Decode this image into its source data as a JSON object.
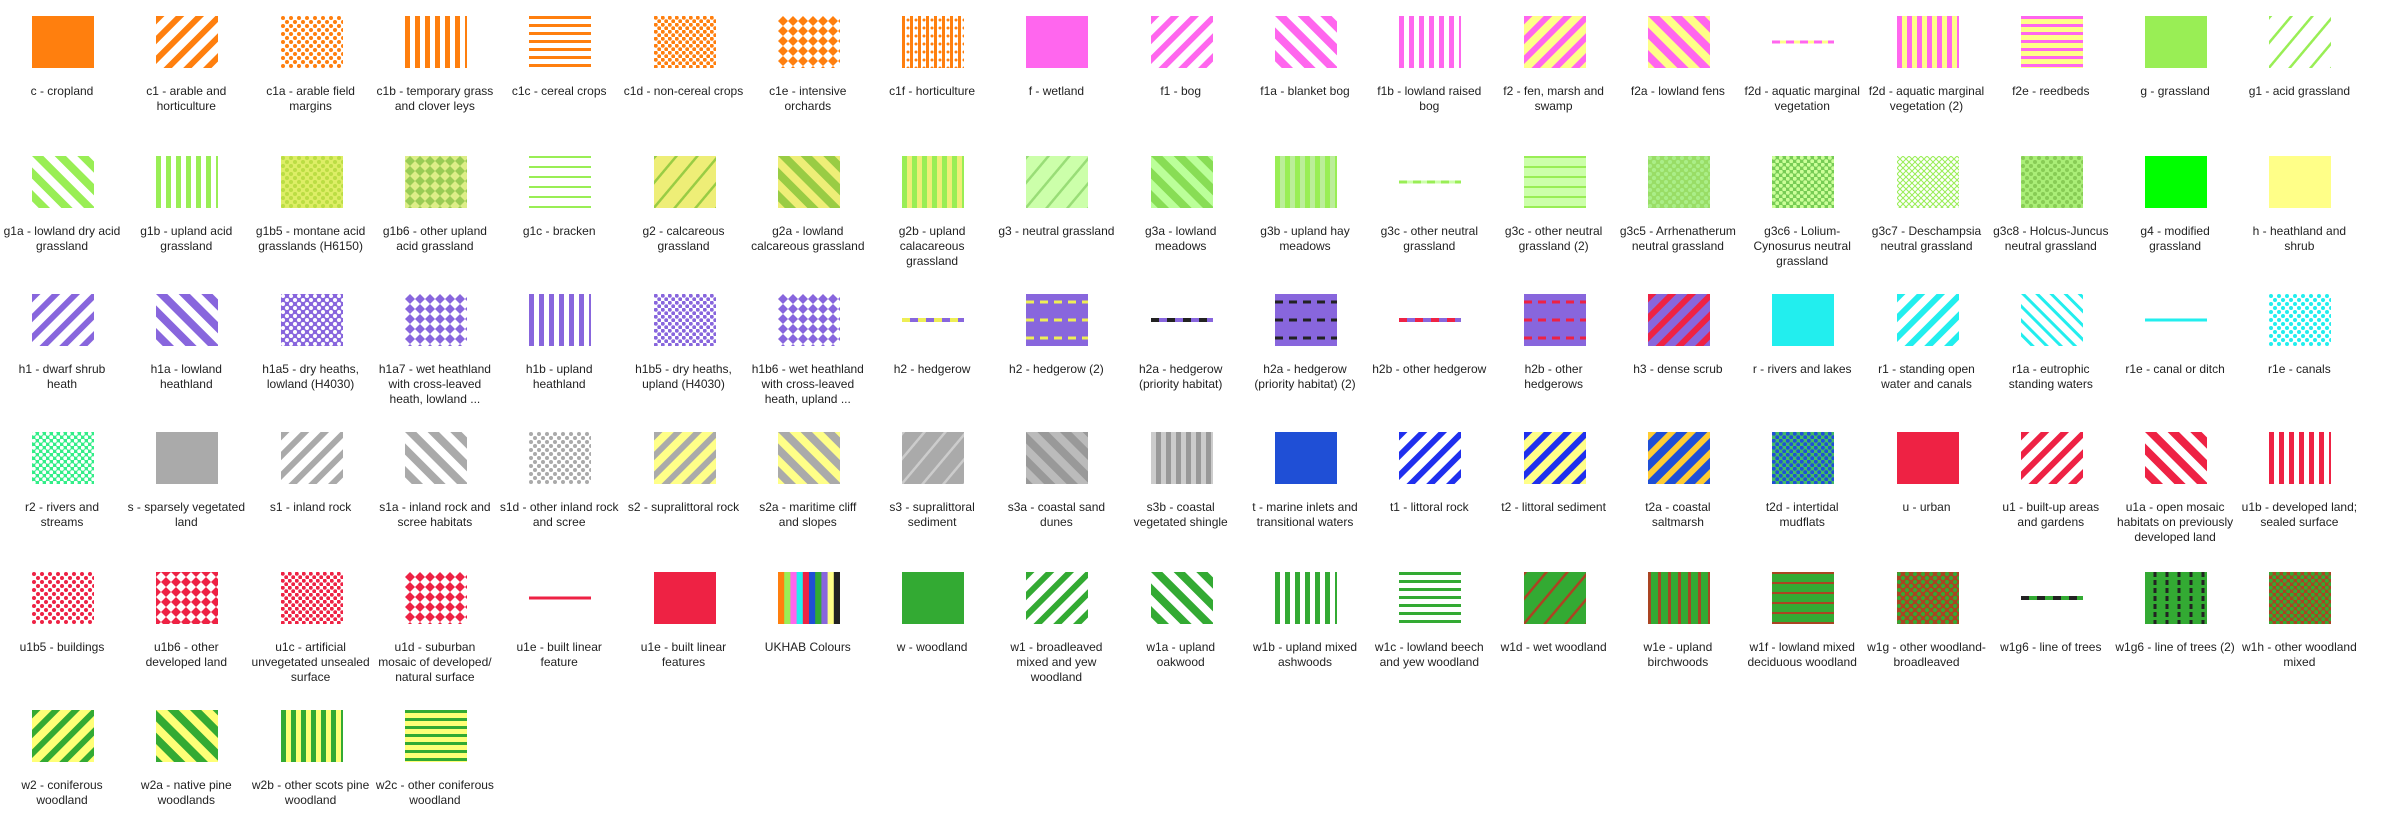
{
  "items": [
    {
      "label": "c - cropland",
      "fill": "solid",
      "color": "#ff7f0e",
      "bg": "#ff7f0e"
    },
    {
      "label": "c1 - arable and horticulture",
      "fill": "diag_fwd",
      "color": "#ff7f0e",
      "bg": "#ffffff"
    },
    {
      "label": "c1a - arable field margins",
      "fill": "dots",
      "color": "#ff7f0e",
      "bg": "#ffffff"
    },
    {
      "label": "c1b - temporary grass and clover leys",
      "fill": "vertical",
      "color": "#ff7f0e",
      "bg": "#ffffff"
    },
    {
      "label": "c1c - cereal crops",
      "fill": "horizontal",
      "color": "#ff7f0e",
      "bg": "#ffffff"
    },
    {
      "label": "c1d - non-cereal crops",
      "fill": "dots_dense",
      "color": "#ff7f0e",
      "bg": "#ffffff"
    },
    {
      "label": "c1e - intensive orchards",
      "fill": "diamonds",
      "color": "#ff7f0e",
      "bg": "#ffffff"
    },
    {
      "label": "c1f - horticulture",
      "fill": "dots_vertical",
      "color": "#ff7f0e",
      "bg": "#ffffff"
    },
    {
      "label": "f - wetland",
      "fill": "solid",
      "color": "#ff66ee",
      "bg": "#ff66ee"
    },
    {
      "label": "f1 - bog",
      "fill": "diag_fwd",
      "color": "#ff66ee",
      "bg": "#ffffff"
    },
    {
      "label": "f1a - blanket bog",
      "fill": "diag_back",
      "color": "#ff66ee",
      "bg": "#ffffff"
    },
    {
      "label": "f1b - lowland raised bog",
      "fill": "vertical",
      "color": "#ff66ee",
      "bg": "#ffffff"
    },
    {
      "label": "f2 - fen, marsh and swamp",
      "fill": "diag_fwd",
      "color": "#ff66ee",
      "bg": "#ffff88"
    },
    {
      "label": "f2a - lowland fens",
      "fill": "diag_back",
      "color": "#ff66ee",
      "bg": "#ffff88"
    },
    {
      "label": "f2d - aquatic marginal vegetation",
      "fill": "line_dash",
      "color": "#ff66ee",
      "bg": "#ffff88"
    },
    {
      "label": "f2d - aquatic marginal vegetation (2)",
      "fill": "vertical",
      "color": "#ff66ee",
      "bg": "#ffff88"
    },
    {
      "label": "f2e - reedbeds",
      "fill": "horizontal",
      "color": "#ff66ee",
      "bg": "#ffff88"
    },
    {
      "label": "g - grassland",
      "fill": "solid",
      "color": "#99ee55",
      "bg": "#99ee55"
    },
    {
      "label": "g1 - acid grassland",
      "fill": "diag_fwd_thin",
      "color": "#99ee55",
      "bg": "#ffffff"
    },
    {
      "label": "g1a - lowland dry acid grassland",
      "fill": "diag_back",
      "color": "#99ee55",
      "bg": "#ffffff"
    },
    {
      "label": "g1b - upland acid grassland",
      "fill": "vertical",
      "color": "#99ee55",
      "bg": "#ffffff"
    },
    {
      "label": "g1b5 - montane acid grasslands (H6150)",
      "fill": "dots",
      "color": "#bbdd44",
      "bg": "#ddee66"
    },
    {
      "label": "g1b6 - other upland acid grassland",
      "fill": "diamonds",
      "color": "#99cc55",
      "bg": "#ddee88"
    },
    {
      "label": "g1c - bracken",
      "fill": "horizontal_thin",
      "color": "#99ee55",
      "bg": "#ffffff"
    },
    {
      "label": "g2 - calcareous grassland",
      "fill": "diag_fwd_thin",
      "color": "#99cc44",
      "bg": "#eeee77"
    },
    {
      "label": "g2a - lowland calcareous grassland",
      "fill": "diag_back",
      "color": "#99cc44",
      "bg": "#eeee77"
    },
    {
      "label": "g2b - upland calacareous grassland",
      "fill": "vertical",
      "color": "#99ee55",
      "bg": "#eeee77"
    },
    {
      "label": "g3 - neutral grassland",
      "fill": "diag_fwd_thin",
      "color": "#99dd77",
      "bg": "#ccffaa"
    },
    {
      "label": "g3a - lowland meadows",
      "fill": "diag_back",
      "color": "#88dd55",
      "bg": "#bbff99"
    },
    {
      "label": "g3b - upland hay meadows",
      "fill": "vertical",
      "color": "#99ee55",
      "bg": "#bbee99"
    },
    {
      "label": "g3c - other neutral grassland",
      "fill": "line_dash",
      "color": "#99ee55",
      "bg": "#ccffaa"
    },
    {
      "label": "g3c - other neutral grassland (2)",
      "fill": "horizontal_thin",
      "color": "#99ee55",
      "bg": "#ccffaa"
    },
    {
      "label": "g3c5 - Arrhenatherum neutral grassland",
      "fill": "dots",
      "color": "#aaee88",
      "bg": "#99dd66"
    },
    {
      "label": "g3c6 - Lolium-Cynosurus neutral grassland",
      "fill": "dots_dense",
      "color": "#ccff99",
      "bg": "#77cc55"
    },
    {
      "label": "g3c7 - Deschampsia neutral grassland",
      "fill": "crosshatch",
      "color": "#99ee55",
      "bg": "#ffffff"
    },
    {
      "label": "g3c8 - Holcus-Juncus neutral grassland",
      "fill": "dots",
      "color": "#88cc55",
      "bg": "#aaee77"
    },
    {
      "label": "g4 - modified grassland",
      "fill": "solid",
      "color": "#00ff00",
      "bg": "#00ff00"
    },
    {
      "label": "h - heathland and shrub",
      "fill": "solid",
      "color": "#ffff88",
      "bg": "#ffff88"
    },
    {
      "label": "h1 - dwarf shrub heath",
      "fill": "diag_fwd",
      "color": "#8866dd",
      "bg": "#ffffff"
    },
    {
      "label": "h1a - lowland heathland",
      "fill": "diag_back",
      "color": "#8866dd",
      "bg": "#ffffff"
    },
    {
      "label": "h1a5 - dry heaths, lowland (H4030)",
      "fill": "dots",
      "color": "#ffffff",
      "bg": "#8866dd"
    },
    {
      "label": "h1a7 - wet heathland with cross-leaved heath, lowland ...",
      "fill": "diamonds",
      "color": "#8866dd",
      "bg": "#ffffff"
    },
    {
      "label": "h1b - upland heathland",
      "fill": "vertical",
      "color": "#8866dd",
      "bg": "#ffffff"
    },
    {
      "label": "h1b5 - dry heaths, upland (H4030)",
      "fill": "dots_dense",
      "color": "#8866dd",
      "bg": "#ffffff"
    },
    {
      "label": "h1b6 - wet heathland with cross-leaved heath, upland ...",
      "fill": "diamonds",
      "color": "#8866dd",
      "bg": "#ffffff"
    },
    {
      "label": "h2 - hedgerow",
      "fill": "line_dash_two",
      "color": "#8866dd",
      "bg": "#eeee55"
    },
    {
      "label": "h2 - hedgerow (2)",
      "fill": "dashes_box",
      "color": "#eeee55",
      "bg": "#8866dd"
    },
    {
      "label": "h2a - hedgerow (priority habitat)",
      "fill": "line_dash_two",
      "color": "#8866dd",
      "bg": "#222222"
    },
    {
      "label": "h2a - hedgerow (priority habitat) (2)",
      "fill": "dashes_box",
      "color": "#222222",
      "bg": "#8866dd"
    },
    {
      "label": "h2b - other hedgerow",
      "fill": "line_dash_two",
      "color": "#8866dd",
      "bg": "#ee2244"
    },
    {
      "label": "h2b - other hedgerows",
      "fill": "dashes_box",
      "color": "#ee2244",
      "bg": "#8866dd"
    },
    {
      "label": "h3 - dense scrub",
      "fill": "diag_fwd",
      "color": "#ee2244",
      "bg": "#8866dd"
    },
    {
      "label": "r - rivers and lakes",
      "fill": "solid",
      "color": "#22eeee",
      "bg": "#22eeee"
    },
    {
      "label": "r1 - standing open water and canals",
      "fill": "diag_fwd",
      "color": "#22eeee",
      "bg": "#ffffff"
    },
    {
      "label": "r1a - eutrophic standing waters",
      "fill": "diag_back_thin",
      "color": "#22eeee",
      "bg": "#ffffff"
    },
    {
      "label": "r1e - canal or ditch",
      "fill": "line_dash",
      "color": "#22eeee",
      "bg": "#ffffff"
    },
    {
      "label": "r1e - canals",
      "fill": "dots",
      "color": "#22eeee",
      "bg": "#ffffff"
    },
    {
      "label": "r2 - rivers and streams",
      "fill": "dots_dense",
      "color": "#ffffff",
      "bg": "#33ee88"
    },
    {
      "label": "s - sparsely vegetated land",
      "fill": "solid",
      "color": "#aaaaaa",
      "bg": "#aaaaaa"
    },
    {
      "label": "s1 - inland rock",
      "fill": "diag_fwd",
      "color": "#aaaaaa",
      "bg": "#ffffff"
    },
    {
      "label": "s1a - inland rock and scree habitats",
      "fill": "diag_back",
      "color": "#aaaaaa",
      "bg": "#ffffff"
    },
    {
      "label": "s1d - other inland rock and scree",
      "fill": "dots",
      "color": "#aaaaaa",
      "bg": "#ffffff"
    },
    {
      "label": "s2 - supralittoral rock",
      "fill": "diag_fwd",
      "color": "#aaaaaa",
      "bg": "#ffff88"
    },
    {
      "label": "s2a - maritime cliff and slopes",
      "fill": "diag_back",
      "color": "#aaaaaa",
      "bg": "#ffff88"
    },
    {
      "label": "s3 - supralittoral sediment",
      "fill": "diag_fwd_thin",
      "color": "#cccccc",
      "bg": "#aaaaaa"
    },
    {
      "label": "s3a - coastal sand dunes",
      "fill": "diag_back",
      "color": "#bbbbbb",
      "bg": "#999999"
    },
    {
      "label": "s3b - coastal vegetated shingle",
      "fill": "vertical",
      "color": "#cccccc",
      "bg": "#999999"
    },
    {
      "label": "t - marine inlets and transitional waters",
      "fill": "solid",
      "color": "#1f4fd6",
      "bg": "#1f4fd6"
    },
    {
      "label": "t1 - littoral rock",
      "fill": "diag_fwd",
      "color": "#1f2fee",
      "bg": "#ffffff"
    },
    {
      "label": "t2 - littoral sediment",
      "fill": "diag_fwd",
      "color": "#1f2fee",
      "bg": "#ffff88"
    },
    {
      "label": "t2a - coastal saltmarsh",
      "fill": "diag_fwd",
      "color": "#ffcc33",
      "bg": "#1f4fd6"
    },
    {
      "label": "t2d - intertidal mudflats",
      "fill": "dots_dense",
      "color": "#1f4fd6",
      "bg": "#44bb66"
    },
    {
      "label": "u - urban",
      "fill": "solid",
      "color": "#ee2244",
      "bg": "#ee2244"
    },
    {
      "label": "u1 - built-up areas and gardens",
      "fill": "diag_fwd",
      "color": "#ee2244",
      "bg": "#ffffff"
    },
    {
      "label": "u1a - open mosaic habitats on previously developed land",
      "fill": "diag_back",
      "color": "#ee2244",
      "bg": "#ffffff"
    },
    {
      "label": "u1b - developed land; sealed surface",
      "fill": "vertical",
      "color": "#ee2244",
      "bg": "#ffffff"
    },
    {
      "label": "u1b5 - buildings",
      "fill": "dots",
      "color": "#ee2244",
      "bg": "#ffffff"
    },
    {
      "label": "u1b6 - other developed land",
      "fill": "diamonds",
      "color": "#ffffff",
      "bg": "#ee2244"
    },
    {
      "label": "u1c - artificial unvegetated unsealed surface",
      "fill": "dots_dense",
      "color": "#ee2244",
      "bg": "#ffffff"
    },
    {
      "label": "u1d - suburban mosaic of developed/ natural surface",
      "fill": "diamonds",
      "color": "#ee2244",
      "bg": "#ffffff"
    },
    {
      "label": "u1e - built linear feature",
      "fill": "line_dash",
      "color": "#ee2244",
      "bg": "#ee2244"
    },
    {
      "label": "u1e - built linear features",
      "fill": "solid",
      "color": "#ee2244",
      "bg": "#ee2244"
    },
    {
      "label": "UKHAB Colours",
      "fill": "rainbow",
      "color": "#ffffff",
      "bg": "#ffffff"
    },
    {
      "label": "w - woodland",
      "fill": "solid",
      "color": "#33aa33",
      "bg": "#33aa33"
    },
    {
      "label": "w1 - broadleaved mixed and yew woodland",
      "fill": "diag_fwd",
      "color": "#33aa33",
      "bg": "#ffffff"
    },
    {
      "label": "w1a - upland oakwood",
      "fill": "diag_back",
      "color": "#33aa33",
      "bg": "#ffffff"
    },
    {
      "label": "w1b - upland mixed ashwoods",
      "fill": "vertical",
      "color": "#33aa33",
      "bg": "#ffffff"
    },
    {
      "label": "w1c - lowland beech and yew woodland",
      "fill": "horizontal",
      "color": "#33aa33",
      "bg": "#ffffff"
    },
    {
      "label": "w1d - wet woodland",
      "fill": "diag_fwd_thin",
      "color": "#aa4422",
      "bg": "#33aa33"
    },
    {
      "label": "w1e - upland birchwoods",
      "fill": "vertical_thin",
      "color": "#aa4422",
      "bg": "#33aa33"
    },
    {
      "label": "w1f - lowland mixed deciduous woodland",
      "fill": "horizontal_thin",
      "color": "#aa4422",
      "bg": "#33aa33"
    },
    {
      "label": "w1g - other woodland-broadleaved",
      "fill": "dots",
      "color": "#33aa33",
      "bg": "#aa4422"
    },
    {
      "label": "w1g6 - line of trees",
      "fill": "line_dash_two",
      "color": "#33aa33",
      "bg": "#222222"
    },
    {
      "label": "w1g6 - line of trees (2)",
      "fill": "dashes_vert",
      "color": "#222222",
      "bg": "#33aa33"
    },
    {
      "label": "w1h - other woodland mixed",
      "fill": "dots_dense",
      "color": "#33aa33",
      "bg": "#aa4422"
    },
    {
      "label": "w2 - coniferous woodland",
      "fill": "diag_fwd",
      "color": "#33aa33",
      "bg": "#ffff77"
    },
    {
      "label": "w2a - native pine woodlands",
      "fill": "diag_back",
      "color": "#ffff77",
      "bg": "#33aa33"
    },
    {
      "label": "w2b - other scots pine woodland",
      "fill": "vertical",
      "color": "#33aa33",
      "bg": "#ffff77"
    },
    {
      "label": "w2c - other coniferous woodland",
      "fill": "horizontal",
      "color": "#33aa33",
      "bg": "#ffff77"
    }
  ],
  "rainbow_colors": [
    "#ff7f0e",
    "#99ee55",
    "#ff66ee",
    "#22eeee",
    "#ee2244",
    "#1f4fd6",
    "#33aa33",
    "#8866dd",
    "#ffff88",
    "#222222"
  ]
}
